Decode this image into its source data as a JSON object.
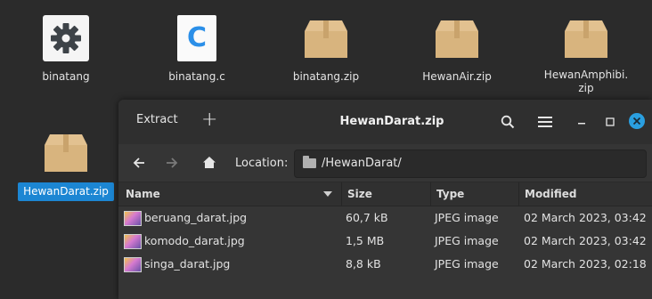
{
  "desktop": {
    "icons": [
      {
        "label": "binatang",
        "icon": "settings-app-icon"
      },
      {
        "label": "binatang.c",
        "icon": "c-file-icon",
        "glyph": "C"
      },
      {
        "label": "binatang.zip",
        "icon": "archive-box-icon"
      },
      {
        "label": "HewanAir.zip",
        "icon": "archive-box-icon"
      },
      {
        "label": "HewanAmphibi.\nzip",
        "icon": "archive-box-icon"
      },
      {
        "label": "HewanDarat.zip",
        "icon": "archive-box-icon",
        "selected": true
      }
    ]
  },
  "window": {
    "extract_label": "Extract",
    "add_label": "+",
    "title": "HewanDarat.zip",
    "location_label": "Location:",
    "location_path": "/HewanDarat/",
    "columns": {
      "name": "Name",
      "size": "Size",
      "type": "Type",
      "modified": "Modified"
    },
    "files": [
      {
        "name": "beruang_darat.jpg",
        "size": "60,7 kB",
        "type": "JPEG image",
        "modified": "02 March 2023, 03:42"
      },
      {
        "name": "komodo_darat.jpg",
        "size": "1,5 MB",
        "type": "JPEG image",
        "modified": "02 March 2023, 03:42"
      },
      {
        "name": "singa_darat.jpg",
        "size": "8,8 kB",
        "type": "JPEG image",
        "modified": "02 March 2023, 02:18"
      }
    ]
  },
  "colors": {
    "accent": "#1c86d3",
    "close_button": "#2a9fe0",
    "archive": "#d8b47e"
  }
}
